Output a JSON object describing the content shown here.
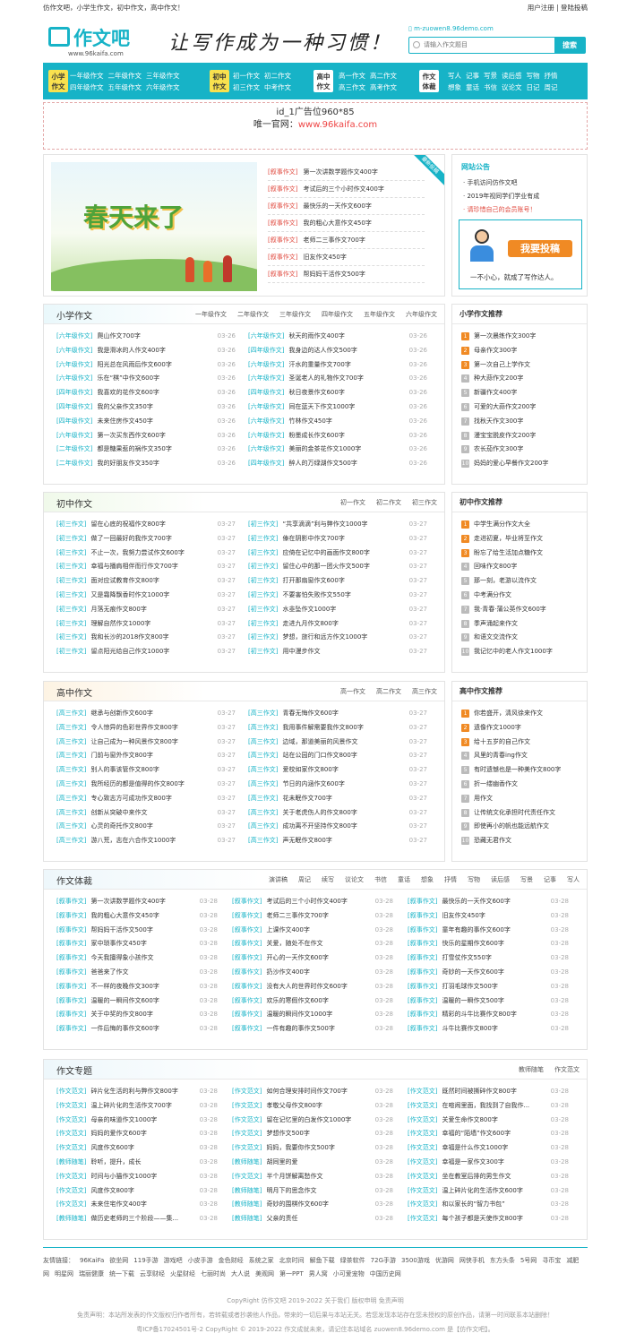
{
  "topbar": {
    "left": "仿作文吧，小学生作文，初中作文，高中作文！",
    "right": "用户注册 | 登陆投稿"
  },
  "header": {
    "logo_name": "作文吧",
    "logo_url": "www.96kaifa.com",
    "slogan": "让写作成为一种习惯！",
    "mobile": "m-zuowen8.96demo.com",
    "search_placeholder": "请输入作文题目",
    "search_button": "搜索"
  },
  "nav": [
    {
      "badge": "小学作文",
      "color": "#f9e14e",
      "rows": [
        [
          "一年级作文",
          "二年级作文",
          "三年级作文"
        ],
        [
          "四年级作文",
          "五年级作文",
          "六年级作文"
        ]
      ]
    },
    {
      "badge": "初中作文",
      "color": "#f9e14e",
      "rows": [
        [
          "初一作文",
          "初二作文"
        ],
        [
          "初三作文",
          "中考作文"
        ]
      ]
    },
    {
      "badge": "高中作文",
      "color": "#fff",
      "rows": [
        [
          "高一作文",
          "高二作文"
        ],
        [
          "高三作文",
          "高考作文"
        ]
      ]
    },
    {
      "badge": "作文体裁",
      "color": "#fff",
      "rows": [
        [
          "写人",
          "记事",
          "写景",
          "读后感",
          "写物",
          "抒情"
        ],
        [
          "想象",
          "童话",
          "书信",
          "议论文",
          "日记",
          "周记"
        ]
      ]
    }
  ],
  "ad": {
    "line1": "id_1广告位960*85",
    "line2_prefix": "唯一官网：",
    "line2_url": "www.96kaifa.com"
  },
  "banner": {
    "image_title": "春天来了",
    "ribbon": "最新投稿",
    "items": [
      {
        "cat": "[叙事作文]",
        "title": "第一次讲数学题作文400字"
      },
      {
        "cat": "[叙事作文]",
        "title": "考试后的三个小时作文400字"
      },
      {
        "cat": "[叙事作文]",
        "title": "最快乐的一天作文600字"
      },
      {
        "cat": "[叙事作文]",
        "title": "我的粗心大意作文450字"
      },
      {
        "cat": "[叙事作文]",
        "title": "老师二三事作文700字"
      },
      {
        "cat": "[叙事作文]",
        "title": "旧友作文450字"
      },
      {
        "cat": "[叙事作文]",
        "title": "帮妈妈干活作文500字"
      }
    ]
  },
  "notice": {
    "title": "网站公告",
    "items": [
      "手机访问仿作文吧",
      "2019年视同学们学业有成",
      "请珍惜自己的会员账号！"
    ],
    "contrib_button": "我要投稿",
    "contrib_tag": "一不小心，就成了写作达人。"
  },
  "primary": {
    "title": "小学作文",
    "tabs": [
      "一年级作文",
      "二年级作文",
      "三年级作文",
      "四年级作文",
      "五年级作文",
      "六年级作文"
    ],
    "left": [
      [
        "[六年级作文]",
        "爬山作文700字",
        "03-26"
      ],
      [
        "[六年级作文]",
        "我是滑冰的人作文400字",
        "03-26"
      ],
      [
        "[六年级作文]",
        "阳光总在风雨后作文600字",
        "03-26"
      ],
      [
        "[六年级作文]",
        "乐在“棋”中作文600字",
        "03-26"
      ],
      [
        "[四年级作文]",
        "我喜欢的花作文600字",
        "03-26"
      ],
      [
        "[四年级作文]",
        "我的父亲作文350字",
        "03-26"
      ],
      [
        "[四年级作文]",
        "未来住房作文450字",
        "03-26"
      ],
      [
        "[六年级作文]",
        "第一次买东西作文600字",
        "03-26"
      ],
      [
        "[二年级作文]",
        "都是糖果惹的祸作文350字",
        "03-26"
      ],
      [
        "[二年级作文]",
        "我的好朋友作文350字",
        "03-26"
      ]
    ],
    "right": [
      [
        "[六年级作文]",
        "秋天的雨作文400字",
        "03-26"
      ],
      [
        "[四年级作文]",
        "我身边的达人作文500字",
        "03-26"
      ],
      [
        "[六年级作文]",
        "汗水的重量作文700字",
        "03-26"
      ],
      [
        "[六年级作文]",
        "圣诞老人的礼物作文700字",
        "03-26"
      ],
      [
        "[四年级作文]",
        "秋日夜景作文600字",
        "03-26"
      ],
      [
        "[六年级作文]",
        "同在蓝天下作文1000字",
        "03-26"
      ],
      [
        "[六年级作文]",
        "竹林作文450字",
        "03-26"
      ],
      [
        "[六年级作文]",
        "粉墨成长作文600字",
        "03-26"
      ],
      [
        "[六年级作文]",
        "美丽的金茶花作文1000字",
        "03-26"
      ],
      [
        "[四年级作文]",
        "醉人的万绿湖作文500字",
        "03-26"
      ]
    ],
    "side_title": "小学作文推荐",
    "side": [
      "第一次晨练作文300字",
      "母亲作文300字",
      "第一次自己上学作文",
      "种大蒜作文200字",
      "新疆作文400字",
      "可爱的大蒜作文200字",
      "找秋天作文300字",
      "漫宝宝脱皮作文200字",
      "农长茄作文300字",
      "妈妈的爱心早餐作文200字"
    ]
  },
  "middle": {
    "title": "初中作文",
    "tabs": [
      "初一作文",
      "初二作文",
      "初三作文"
    ],
    "left": [
      [
        "[初三作文]",
        "留在心底的祝福作文800字",
        "03-27"
      ],
      [
        "[初三作文]",
        "做了一回最好的我作文700字",
        "03-27"
      ],
      [
        "[初三作文]",
        "不止一次，我努力尝试作文600字",
        "03-27"
      ],
      [
        "[初三作文]",
        "幸福与播肩相伴而行作文700字",
        "03-27"
      ],
      [
        "[初三作文]",
        "面对应试教育作文800字",
        "03-27"
      ],
      [
        "[初三作文]",
        "又是霜降飘香时作文1000字",
        "03-27"
      ],
      [
        "[初三作文]",
        "月落无痕作文800字",
        "03-27"
      ],
      [
        "[初三作文]",
        "理解自然作文1000字",
        "03-27"
      ],
      [
        "[初三作文]",
        "我和长沙的2018作文800字",
        "03-27"
      ],
      [
        "[初三作文]",
        "留点阳光给自己作文1000字",
        "03-27"
      ]
    ],
    "right": [
      [
        "[初三作文]",
        "“共享滴滴”利与弊作文1000字",
        "03-27"
      ],
      [
        "[初三作文]",
        "傣在阴影中作文700字",
        "03-27"
      ],
      [
        "[初三作文]",
        "应倚在记忆中的画面作文800字",
        "03-27"
      ],
      [
        "[初三作文]",
        "留住心中的那一团火作文500字",
        "03-27"
      ],
      [
        "[初三作文]",
        "打开那扇窗作文600字",
        "03-27"
      ],
      [
        "[初三作文]",
        "不要害怕失败作文550字",
        "03-27"
      ],
      [
        "[初三作文]",
        "水韭坠作文1000字",
        "03-27"
      ],
      [
        "[初三作文]",
        "走进九月作文800字",
        "03-27"
      ],
      [
        "[初三作文]",
        "梦想，旅行和远方作文1000字",
        "03-27"
      ],
      [
        "[初三作文]",
        "用中漫步作文",
        "03-27"
      ]
    ],
    "side_title": "初中作文推荐",
    "side": [
      "中学生满分作文大全",
      "走进初夏，毕业将至作文",
      "盼忘了给生活加点糖作文",
      "回味作文800字",
      "那一刻，老游以流作文",
      "中考满分作文",
      "我·青春·蒲公英作文600字",
      "季声涌起来作文",
      "和语文交流作文",
      "我记忆中的老人作文1000字"
    ]
  },
  "high": {
    "title": "高中作文",
    "tabs": [
      "高一作文",
      "高二作文",
      "高三作文"
    ],
    "left": [
      [
        "[高三作文]",
        "继承与创新作文600字",
        "03-27"
      ],
      [
        "[高三作文]",
        "令人惊异的色彩世界作文800字",
        "03-27"
      ],
      [
        "[高三作文]",
        "让自己成为一种风景作文800字",
        "03-27"
      ],
      [
        "[高三作文]",
        "门前与窗外作文800字",
        "03-27"
      ],
      [
        "[高三作文]",
        "别人的事该管作文800字",
        "03-27"
      ],
      [
        "[高三作文]",
        "我所经历的都是值得的作文800字",
        "03-27"
      ],
      [
        "[高三作文]",
        "专心致志方可成功作文800字",
        "03-27"
      ],
      [
        "[高三作文]",
        "创新从突破中来作文",
        "03-27"
      ],
      [
        "[高三作文]",
        "心灵的奇托作文800字",
        "03-27"
      ],
      [
        "[高三作文]",
        "游八荒，志在六合作文1000字",
        "03-27"
      ]
    ],
    "right": [
      [
        "[高三作文]",
        "青春无悔作文600字",
        "03-27"
      ],
      [
        "[高三作文]",
        "我用事件解需要我作文800字",
        "03-27"
      ],
      [
        "[高三作文]",
        "边域，那道美丽的风景作文",
        "03-27"
      ],
      [
        "[高三作文]",
        "站在公园的门口作文800字",
        "03-27"
      ],
      [
        "[高三作文]",
        "爱校如家作文800字",
        "03-27"
      ],
      [
        "[高三作文]",
        "节日的内涵作文600字",
        "03-27"
      ],
      [
        "[高三作文]",
        "花未眠作文700字",
        "03-27"
      ],
      [
        "[高三作文]",
        "关于老虎伤人的作文800字",
        "03-27"
      ],
      [
        "[高三作文]",
        "成功离不开坚持作文800字",
        "03-27"
      ],
      [
        "[高三作文]",
        "声无眠作文800字",
        "03-27"
      ]
    ],
    "side_title": "高中作文推荐",
    "side": [
      "你若盛开，清风徐来作文",
      "遗像作文1000字",
      "给十五岁的自己作文",
      "风里的青春ing作文",
      "有时遗憾也是一种美作文800字",
      "折一缕幽香作文",
      "用作文",
      "让传统文化承担时代责任作文",
      "即使再小的帆也能远航作文",
      "恐藏无君作文"
    ]
  },
  "genre": {
    "title": "作文体裁",
    "tabs": [
      "演讲稿",
      "周记",
      "续写",
      "议论文",
      "书信",
      "童话",
      "想象",
      "抒情",
      "写物",
      "读后感",
      "写景",
      "记事",
      "写人"
    ],
    "cols": [
      [
        [
          "[叙事作文]",
          "第一次讲数学题作文400字",
          "03-28"
        ],
        [
          "[叙事作文]",
          "我的粗心大意作文450字",
          "03-28"
        ],
        [
          "[叙事作文]",
          "帮妈妈干活作文500字",
          "03-28"
        ],
        [
          "[叙事作文]",
          "家中琐事作文450字",
          "03-28"
        ],
        [
          "[叙事作文]",
          "今天我擅得象小孩作文",
          "03-28"
        ],
        [
          "[叙事作文]",
          "爸爸来了作文",
          "03-28"
        ],
        [
          "[叙事作文]",
          "不一样的夜晚作文300字",
          "03-28"
        ],
        [
          "[叙事作文]",
          "温暖的一瞬间作文600字",
          "03-28"
        ],
        [
          "[叙事作文]",
          "关于中奖的作文800字",
          "03-28"
        ],
        [
          "[叙事作文]",
          "一件后悔的事作文600字",
          "03-28"
        ]
      ],
      [
        [
          "[叙事作文]",
          "考试后的三个小时作文400字",
          "03-28"
        ],
        [
          "[叙事作文]",
          "老师二三事作文700字",
          "03-28"
        ],
        [
          "[叙事作文]",
          "上课作文400字",
          "03-28"
        ],
        [
          "[叙事作文]",
          "关爱，随处不在作文",
          "03-28"
        ],
        [
          "[叙事作文]",
          "开心的一天作文600字",
          "03-28"
        ],
        [
          "[叙事作文]",
          "扔沙作文400字",
          "03-28"
        ],
        [
          "[叙事作文]",
          "没有大人的世界时作文600字",
          "03-28"
        ],
        [
          "[叙事作文]",
          "欢乐的寒假作文600字",
          "03-28"
        ],
        [
          "[叙事作文]",
          "温暖的瞬间作文1000字",
          "03-28"
        ],
        [
          "[叙事作文]",
          "一件有趣的事作文500字",
          "03-28"
        ]
      ],
      [
        [
          "[叙事作文]",
          "最快乐的一天作文600字",
          "03-28"
        ],
        [
          "[叙事作文]",
          "旧友作文450字",
          "03-28"
        ],
        [
          "[叙事作文]",
          "童年有趣的事作文600字",
          "03-28"
        ],
        [
          "[叙事作文]",
          "快乐的星期作文600字",
          "03-28"
        ],
        [
          "[叙事作文]",
          "打雪仗作文550字",
          "03-28"
        ],
        [
          "[叙事作文]",
          "奇妙的一天作文600字",
          "03-28"
        ],
        [
          "[叙事作文]",
          "打羽毛球作文500字",
          "03-28"
        ],
        [
          "[叙事作文]",
          "温暖的一瞬作文500字",
          "03-28"
        ],
        [
          "[叙事作文]",
          "精彩的斗牛比赛作文800字",
          "03-28"
        ],
        [
          "[叙事作文]",
          "斗牛比赛作文800字",
          "03-28"
        ]
      ]
    ]
  },
  "topic": {
    "title": "作文专题",
    "tabs": [
      "教师随笔",
      "作文范文"
    ],
    "cols": [
      [
        [
          "[作文范文]",
          "碎片化生活的利与弊作文800字",
          "03-28"
        ],
        [
          "[作文范文]",
          "温上碎片化的生活作文700字",
          "03-28"
        ],
        [
          "[作文范文]",
          "母亲的味道作文1000字",
          "03-28"
        ],
        [
          "[作文范文]",
          "妈妈的爱作文600字",
          "03-28"
        ],
        [
          "[作文范文]",
          "风度作文600字",
          "03-28"
        ],
        [
          "[教师随笔]",
          "聆听，提升，成长",
          "03-28"
        ],
        [
          "[作文范文]",
          "时间与小猫作文1000字",
          "03-28"
        ],
        [
          "[作文范文]",
          "风度作文800字",
          "03-28"
        ],
        [
          "[作文范文]",
          "未来住宅作文400字",
          "03-28"
        ],
        [
          "[教师随笔]",
          "做历史老师的三个阶段——集...",
          "03-28"
        ]
      ],
      [
        [
          "[作文范文]",
          "如何合理安排时间作文700字",
          "03-28"
        ],
        [
          "[作文范文]",
          "孝敬父母作文800字",
          "03-28"
        ],
        [
          "[作文范文]",
          "留在记忆里的白发作文1000字",
          "03-28"
        ],
        [
          "[作文范文]",
          "梦想作文500字",
          "03-28"
        ],
        [
          "[作文范文]",
          "妈妈，我要你作文500字",
          "03-28"
        ],
        [
          "[教师随笔]",
          "胡同里的爱",
          "03-28"
        ],
        [
          "[作文范文]",
          "半个月饼解离愁作文",
          "03-28"
        ],
        [
          "[教师随笔]",
          "明月下的思念作文",
          "03-28"
        ],
        [
          "[教师随笔]",
          "奇妙的围棋作文600字",
          "03-28"
        ],
        [
          "[教师随笔]",
          "父亲的责任",
          "03-28"
        ]
      ],
      [
        [
          "[作文范文]",
          "既然时间被撕碎作文800字",
          "03-28"
        ],
        [
          "[作文范文]",
          "在喧闹里面，我找到了自我作...",
          "03-28"
        ],
        [
          "[作文范文]",
          "关爱生命作文800字",
          "03-28"
        ],
        [
          "[作文范文]",
          "幸福的“陌墙”作文600字",
          "03-28"
        ],
        [
          "[作文范文]",
          "幸福是什么作文1000字",
          "03-28"
        ],
        [
          "[作文范文]",
          "幸福是一家作文300字",
          "03-28"
        ],
        [
          "[作文范文]",
          "坐在教室后排的男生作文",
          "03-28"
        ],
        [
          "[作文范文]",
          "温上碎片化的生活作文600字",
          "03-28"
        ],
        [
          "[作文范文]",
          "和以家长的“智力书包”",
          "03-28"
        ],
        [
          "[作文范文]",
          "每个孩子都是天使作文800字",
          "03-28"
        ]
      ]
    ]
  },
  "footer": {
    "links_label": "友情链接：",
    "links": [
      "96KaiFa",
      "欲坐网",
      "119手游",
      "游戏吧",
      "小皮手游",
      "金色财经",
      "系统之家",
      "北京时间",
      "解鱼下载",
      "绿茶软件",
      "72G手游",
      "3500游戏",
      "优游网",
      "网侠手机",
      "东方头条",
      "5号网",
      "寻币宝",
      "减肥网",
      "明星网",
      "瑞丽健康",
      "统一下载",
      "云享财经",
      "火星财经",
      "七丽时尚",
      "大人说",
      "美观网",
      "第一PPT",
      "男人窝",
      "小可爱宠物",
      "中国历史网"
    ],
    "line1": "CopyRight  仿作文吧  2019-2022  关于我们  版权申明  免责声明",
    "line2": "免责声明：本站所发表的作文版权归作者所有，若转载或者抄袭他人作品，带来的一切后果与本站无关。若您发现本站存在您未授权的原创作品，请第一时间联系本站删除！",
    "line3": "粤ICP备17024501号-2  CopyRight © 2019-2022 作文成就未来，请记住本站域名 zuowen8.96demo.com 是【仿作文吧】。"
  }
}
